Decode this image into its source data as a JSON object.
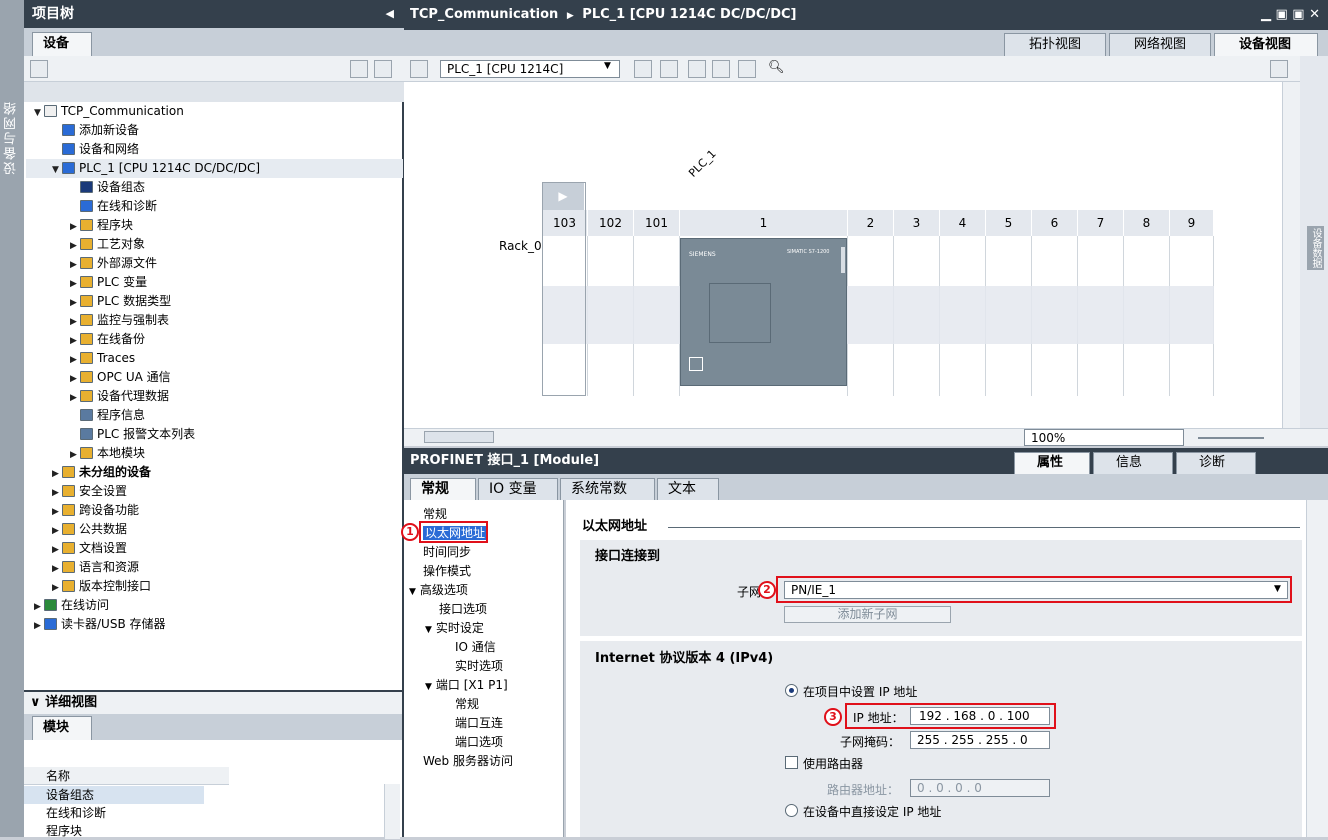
{
  "sidebar_tab": "设备与网络",
  "project_tree": {
    "title": "项目树",
    "tab": "设备",
    "items": [
      {
        "label": "TCP_Communication",
        "arrow": "▼",
        "level": 0,
        "color": "#f0f0f0"
      },
      {
        "label": "添加新设备",
        "arrow": "",
        "level": 1,
        "color": "#2a6bd6"
      },
      {
        "label": "设备和网络",
        "arrow": "",
        "level": 1,
        "color": "#2a6bd6"
      },
      {
        "label": "PLC_1 [CPU 1214C DC/DC/DC]",
        "arrow": "▼",
        "level": 1,
        "color": "#2a6bd6"
      },
      {
        "label": "设备组态",
        "arrow": "",
        "level": 2,
        "color": "#1a3a7a"
      },
      {
        "label": "在线和诊断",
        "arrow": "",
        "level": 2,
        "color": "#2a6bd6"
      },
      {
        "label": "程序块",
        "arrow": "▶",
        "level": 2,
        "color": "#e8b030"
      },
      {
        "label": "工艺对象",
        "arrow": "▶",
        "level": 2,
        "color": "#e8b030"
      },
      {
        "label": "外部源文件",
        "arrow": "▶",
        "level": 2,
        "color": "#e8b030"
      },
      {
        "label": "PLC 变量",
        "arrow": "▶",
        "level": 2,
        "color": "#e8b030"
      },
      {
        "label": "PLC 数据类型",
        "arrow": "▶",
        "level": 2,
        "color": "#e8b030"
      },
      {
        "label": "监控与强制表",
        "arrow": "▶",
        "level": 2,
        "color": "#e8b030"
      },
      {
        "label": "在线备份",
        "arrow": "▶",
        "level": 2,
        "color": "#e8b030"
      },
      {
        "label": "Traces",
        "arrow": "▶",
        "level": 2,
        "color": "#e8b030"
      },
      {
        "label": "OPC UA 通信",
        "arrow": "▶",
        "level": 2,
        "color": "#e8b030"
      },
      {
        "label": "设备代理数据",
        "arrow": "▶",
        "level": 2,
        "color": "#e8b030"
      },
      {
        "label": "程序信息",
        "arrow": "",
        "level": 2,
        "color": "#5a7aa0"
      },
      {
        "label": "PLC 报警文本列表",
        "arrow": "",
        "level": 2,
        "color": "#5a7aa0"
      },
      {
        "label": "本地模块",
        "arrow": "▶",
        "level": 2,
        "color": "#e8b030"
      },
      {
        "label": "未分组的设备",
        "arrow": "▶",
        "level": 1,
        "color": "#e8b030",
        "bold": true
      },
      {
        "label": "安全设置",
        "arrow": "▶",
        "level": 1,
        "color": "#e8b030"
      },
      {
        "label": "跨设备功能",
        "arrow": "▶",
        "level": 1,
        "color": "#e8b030"
      },
      {
        "label": "公共数据",
        "arrow": "▶",
        "level": 1,
        "color": "#e8b030"
      },
      {
        "label": "文档设置",
        "arrow": "▶",
        "level": 1,
        "color": "#e8b030"
      },
      {
        "label": "语言和资源",
        "arrow": "▶",
        "level": 1,
        "color": "#e8b030"
      },
      {
        "label": "版本控制接口",
        "arrow": "▶",
        "level": 1,
        "color": "#e8b030"
      },
      {
        "label": "在线访问",
        "arrow": "▶",
        "level": 0,
        "color": "#2a8a3a"
      },
      {
        "label": "读卡器/USB 存储器",
        "arrow": "▶",
        "level": 0,
        "color": "#2a6bd6"
      }
    ]
  },
  "detail_view": {
    "title": "详细视图",
    "tab": "模块",
    "column": "名称",
    "rows": [
      "设备组态",
      "在线和诊断",
      "程序块"
    ]
  },
  "editor": {
    "breadcrumb_project": "TCP_Communication",
    "breadcrumb_sep": "▶",
    "breadcrumb_device": "PLC_1 [CPU 1214C DC/DC/DC]",
    "view_tabs": [
      "拓扑视图",
      "网络视图",
      "设备视图"
    ],
    "device_select": "PLC_1 [CPU 1214C]",
    "rack_label": "Rack_0",
    "plc_label": "PLC_1",
    "slots": [
      "103",
      "102",
      "101",
      "1",
      "2",
      "3",
      "4",
      "5",
      "6",
      "7",
      "8",
      "9"
    ],
    "cpu_brand": "SIEMENS",
    "cpu_model": "SIMATIC S7-1200",
    "zoom": "100%",
    "right_sidebar": "设备数据"
  },
  "properties": {
    "title": "PROFINET 接口_1 [Module]",
    "header_tabs": [
      "属性",
      "信息",
      "诊断"
    ],
    "tabs": [
      "常规",
      "IO 变量",
      "系统常数",
      "文本"
    ],
    "nav": [
      {
        "label": "常规",
        "indent": 0,
        "arrow": ""
      },
      {
        "label": "以太网地址",
        "indent": 0,
        "arrow": "",
        "selected": true
      },
      {
        "label": "时间同步",
        "indent": 0,
        "arrow": ""
      },
      {
        "label": "操作模式",
        "indent": 0,
        "arrow": ""
      },
      {
        "label": "高级选项",
        "indent": 0,
        "arrow": "▼"
      },
      {
        "label": "接口选项",
        "indent": 1,
        "arrow": ""
      },
      {
        "label": "实时设定",
        "indent": 1,
        "arrow": "▼"
      },
      {
        "label": "IO 通信",
        "indent": 2,
        "arrow": ""
      },
      {
        "label": "实时选项",
        "indent": 2,
        "arrow": ""
      },
      {
        "label": "端口 [X1 P1]",
        "indent": 1,
        "arrow": "▼"
      },
      {
        "label": "常规",
        "indent": 2,
        "arrow": ""
      },
      {
        "label": "端口互连",
        "indent": 2,
        "arrow": ""
      },
      {
        "label": "端口选项",
        "indent": 2,
        "arrow": ""
      },
      {
        "label": "Web 服务器访问",
        "indent": 0,
        "arrow": ""
      }
    ],
    "section_title": "以太网地址",
    "interface_section": "接口连接到",
    "subnet_label": "子网",
    "subnet_value": "PN/IE_1",
    "add_subnet_button": "添加新子网",
    "ipv4_section": "Internet 协议版本 4 (IPv4)",
    "radio_project_ip": "在项目中设置 IP 地址",
    "ip_label": "IP 地址：",
    "ip_value": "192 . 168 .  0   . 100",
    "mask_label": "子网掩码：",
    "mask_value": "255 . 255 . 255 . 0",
    "use_router_label": "使用路由器",
    "router_label": "路由器地址：",
    "router_value": "0   .   0   .   0   .   0",
    "radio_device_ip": "在设备中直接设定 IP 地址",
    "markers": [
      "1",
      "2",
      "3"
    ]
  }
}
